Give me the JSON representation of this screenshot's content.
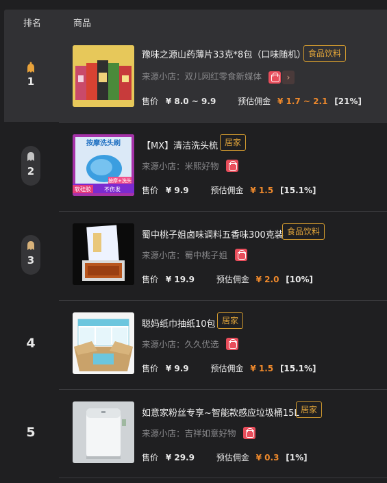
{
  "header": {
    "rank_label": "排名",
    "item_label": "商品"
  },
  "labels": {
    "shop_prefix": "来源小店：",
    "price": "售价",
    "commission": "预估佣金"
  },
  "colors": {
    "accent": "#e0a43a",
    "commission": "#f08a2c",
    "shop_badge": "#e84d5b",
    "gold": "#e8a23a",
    "silver": "#c4c4c4",
    "bronze": "#d8b27a"
  },
  "rows": [
    {
      "rank": "1",
      "medal": "gold-medal-icon",
      "title": "豫味之源山药薄片33克*8包（口味随机）",
      "tag": "食品饮料",
      "shop": "双儿网红零食新媒体",
      "price": "¥ 8.0 ~ 9.9",
      "commission": "¥ 1.7 ~ 2.1",
      "rate": "[21%]"
    },
    {
      "rank": "2",
      "medal": "silver-medal-icon",
      "title": "【MX】清洁洗头梳",
      "tag": "居家",
      "shop": "米熙好物",
      "price": "¥ 9.9",
      "commission": "¥ 1.5",
      "rate": "[15.1%]"
    },
    {
      "rank": "3",
      "medal": "bronze-medal-icon",
      "title": "蜀中桃子姐卤味调料五香味300克装",
      "tag": "食品饮料",
      "shop": "蜀中桃子姐",
      "price": "¥ 19.9",
      "commission": "¥ 2.0",
      "rate": "[10%]"
    },
    {
      "rank": "4",
      "title": "聪妈纸巾抽纸10包",
      "tag": "居家",
      "shop": "久久优选",
      "price": "¥ 9.9",
      "commission": "¥ 1.5",
      "rate": "[15.1%]"
    },
    {
      "rank": "5",
      "title": "如意家粉丝专享~智能款感应垃圾桶15L",
      "tag": "居家",
      "shop": "吉祥如意好物",
      "price": "¥ 29.9",
      "commission": "¥ 0.3",
      "rate": "[1%]"
    }
  ],
  "thumb_texts": {
    "comb_title": "按摩洗头刷",
    "comb_b1": "软硅胶",
    "comb_b2": "不伤发",
    "comb_b3": "按摩+洗头"
  }
}
